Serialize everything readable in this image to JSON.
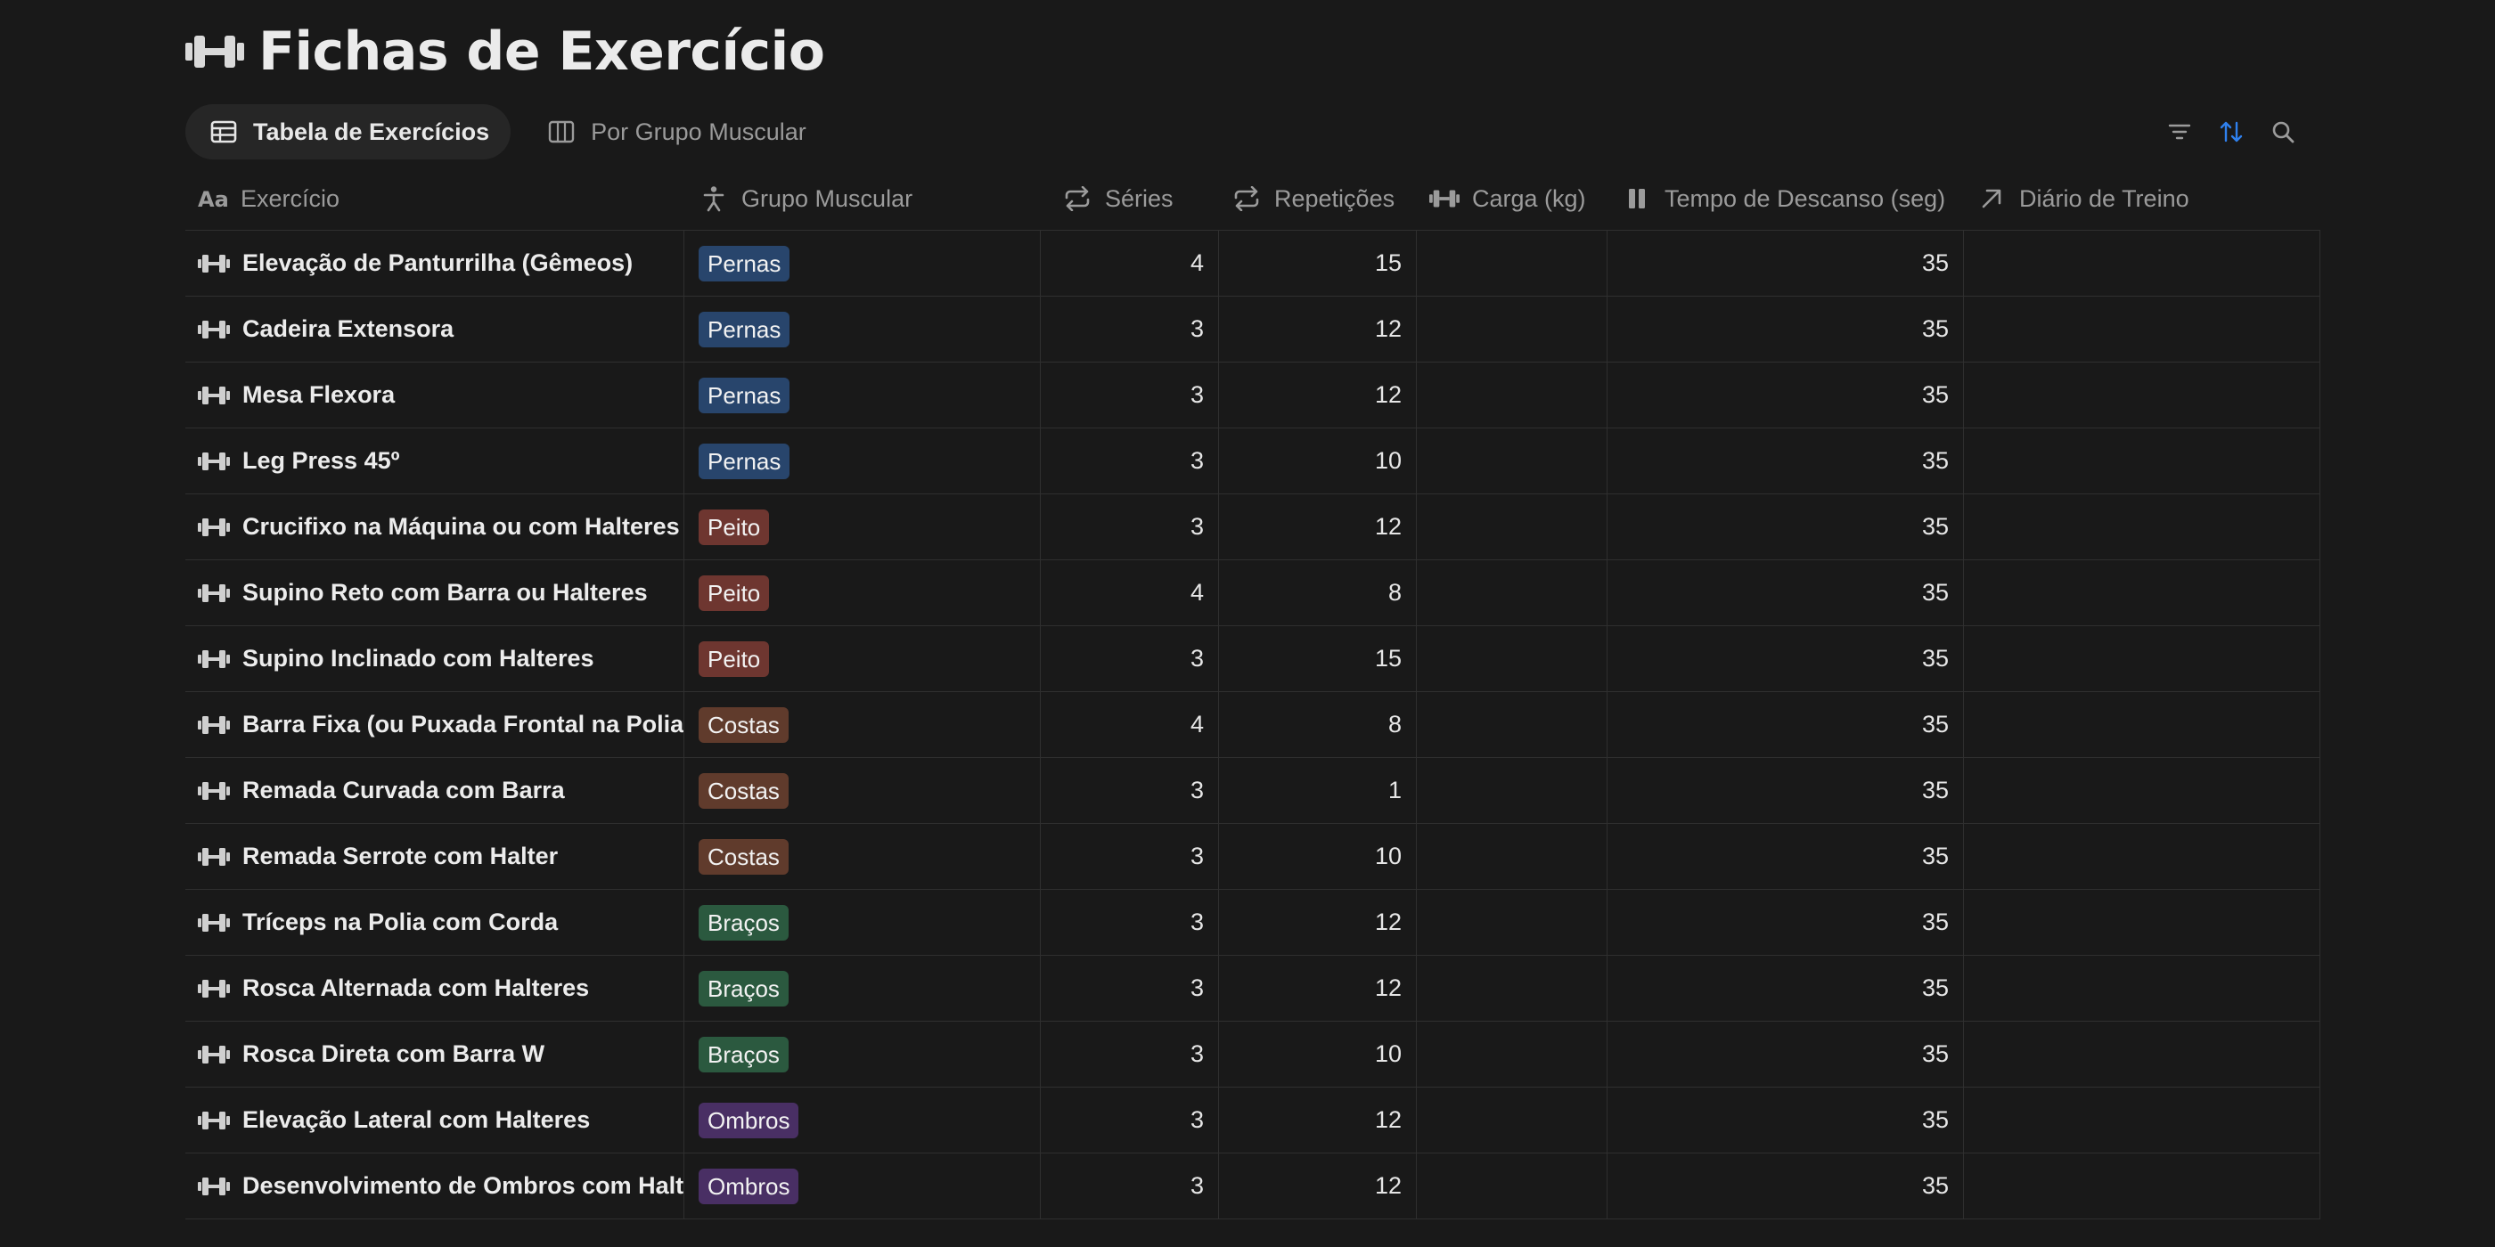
{
  "page": {
    "title": "Fichas de Exercício",
    "title_icon": "dumbbell-icon"
  },
  "views": [
    {
      "label": "Tabela de Exercícios",
      "icon": "table-icon",
      "active": true
    },
    {
      "label": "Por Grupo Muscular",
      "icon": "board-icon",
      "active": false
    }
  ],
  "toolbar": {
    "icons": [
      "filter-icon",
      "sort-icon",
      "search-icon"
    ],
    "sort_active_color": "#2f80ed"
  },
  "columns": [
    {
      "label": "Exercício",
      "icon": "title-aa-icon"
    },
    {
      "label": "Grupo Muscular",
      "icon": "person-icon"
    },
    {
      "label": "Séries",
      "icon": "repeat-icon"
    },
    {
      "label": "Repetições",
      "icon": "repeat-icon"
    },
    {
      "label": "Carga (kg)",
      "icon": "dumbbell-icon"
    },
    {
      "label": "Tempo de Descanso (seg)",
      "icon": "pause-icon"
    },
    {
      "label": "Diário de Treino",
      "icon": "arrow-up-right-icon"
    }
  ],
  "tag_colors": {
    "Pernas": "#28456c",
    "Peito": "#6e3630",
    "Costas": "#603b2c",
    "Braços": "#2b593f",
    "Ombros": "#492f64",
    "Abdômen": "#89632a"
  },
  "rows": [
    {
      "name": "Elevação de Panturrilha (Gêmeos)",
      "group": "Pernas",
      "series": "4",
      "reps": "15",
      "load": "",
      "rest": "35",
      "log": ""
    },
    {
      "name": "Cadeira Extensora",
      "group": "Pernas",
      "series": "3",
      "reps": "12",
      "load": "",
      "rest": "35",
      "log": ""
    },
    {
      "name": "Mesa Flexora",
      "group": "Pernas",
      "series": "3",
      "reps": "12",
      "load": "",
      "rest": "35",
      "log": ""
    },
    {
      "name": "Leg Press 45º",
      "group": "Pernas",
      "series": "3",
      "reps": "10",
      "load": "",
      "rest": "35",
      "log": ""
    },
    {
      "name": "Crucifixo na Máquina ou com Halteres",
      "group": "Peito",
      "series": "3",
      "reps": "12",
      "load": "",
      "rest": "35",
      "log": ""
    },
    {
      "name": "Supino Reto com Barra ou Halteres",
      "group": "Peito",
      "series": "4",
      "reps": "8",
      "load": "",
      "rest": "35",
      "log": ""
    },
    {
      "name": "Supino Inclinado com Halteres",
      "group": "Peito",
      "series": "3",
      "reps": "15",
      "load": "",
      "rest": "35",
      "log": ""
    },
    {
      "name": "Barra Fixa (ou Puxada Frontal na Polia)",
      "group": "Costas",
      "series": "4",
      "reps": "8",
      "load": "",
      "rest": "35",
      "log": ""
    },
    {
      "name": "Remada Curvada com Barra",
      "group": "Costas",
      "series": "3",
      "reps": "1",
      "load": "",
      "rest": "35",
      "log": ""
    },
    {
      "name": "Remada Serrote com Halter",
      "group": "Costas",
      "series": "3",
      "reps": "10",
      "load": "",
      "rest": "35",
      "log": ""
    },
    {
      "name": "Tríceps na Polia com Corda",
      "group": "Braços",
      "series": "3",
      "reps": "12",
      "load": "",
      "rest": "35",
      "log": ""
    },
    {
      "name": "Rosca Alternada com Halteres",
      "group": "Braços",
      "series": "3",
      "reps": "12",
      "load": "",
      "rest": "35",
      "log": ""
    },
    {
      "name": "Rosca Direta com Barra W",
      "group": "Braços",
      "series": "3",
      "reps": "10",
      "load": "",
      "rest": "35",
      "log": ""
    },
    {
      "name": "Elevação Lateral com Halteres",
      "group": "Ombros",
      "series": "3",
      "reps": "12",
      "load": "",
      "rest": "35",
      "log": ""
    },
    {
      "name": "Desenvolvimento de Ombros com Halteres",
      "group": "Ombros",
      "series": "3",
      "reps": "12",
      "load": "",
      "rest": "35",
      "log": ""
    }
  ]
}
